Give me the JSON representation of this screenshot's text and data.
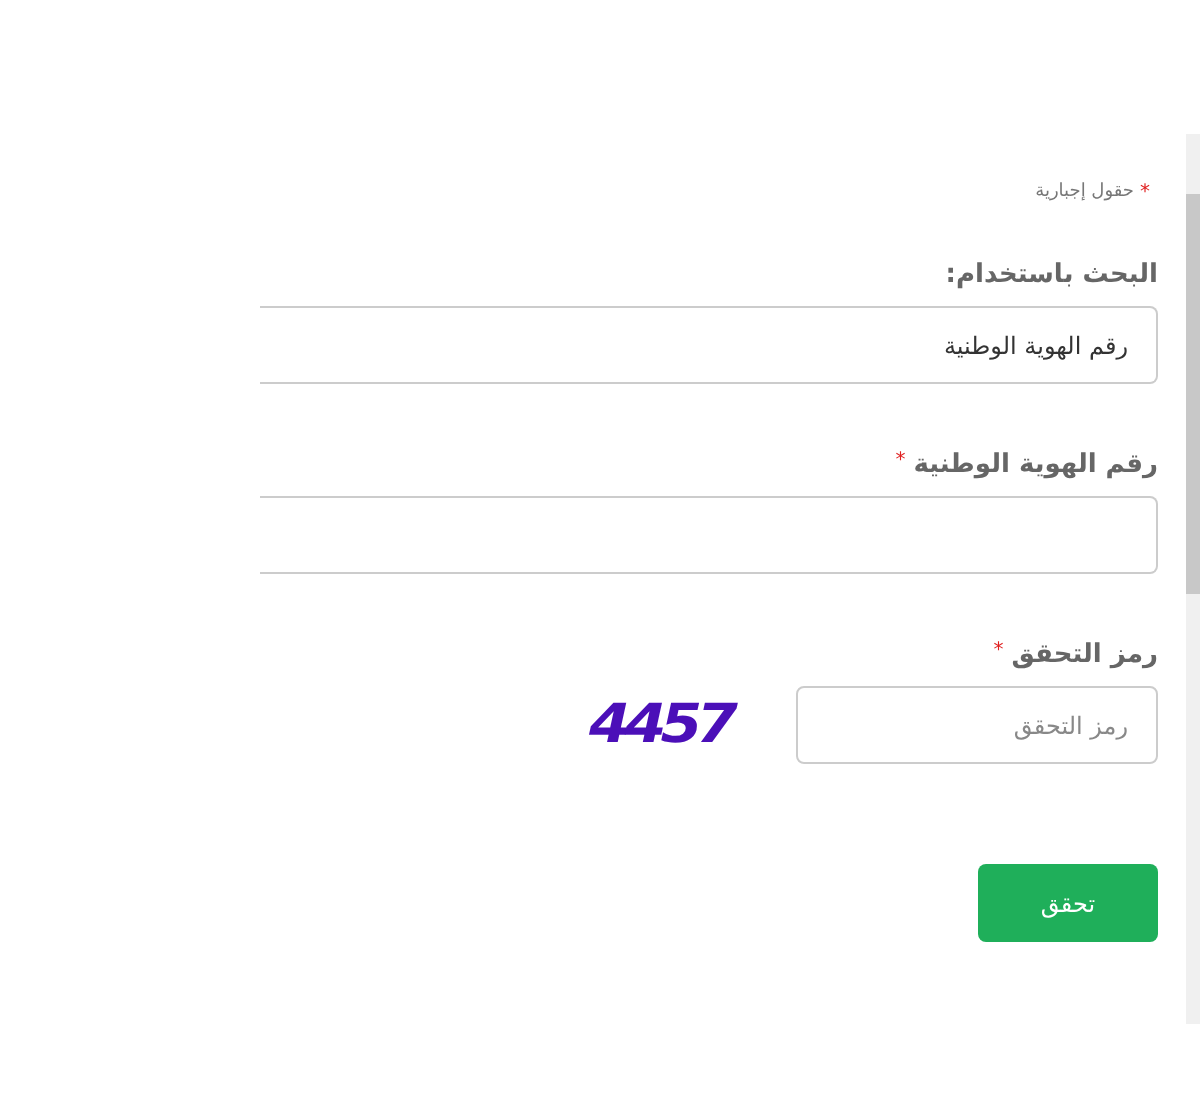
{
  "required_note": {
    "mark": "*",
    "text": "حقول إجبارية"
  },
  "fields": [
    {
      "kind": "select",
      "label": "البحث باستخدام:",
      "value": "رقم الهوية الوطنية"
    },
    {
      "kind": "text",
      "label": "رقم الهوية الوطنية",
      "mark": "*"
    },
    {
      "kind": "captcha",
      "label": "رمز التحقق",
      "mark": "*",
      "placeholder": "رمز التحقق",
      "code": "4457"
    }
  ],
  "submit_button": "تحقق"
}
